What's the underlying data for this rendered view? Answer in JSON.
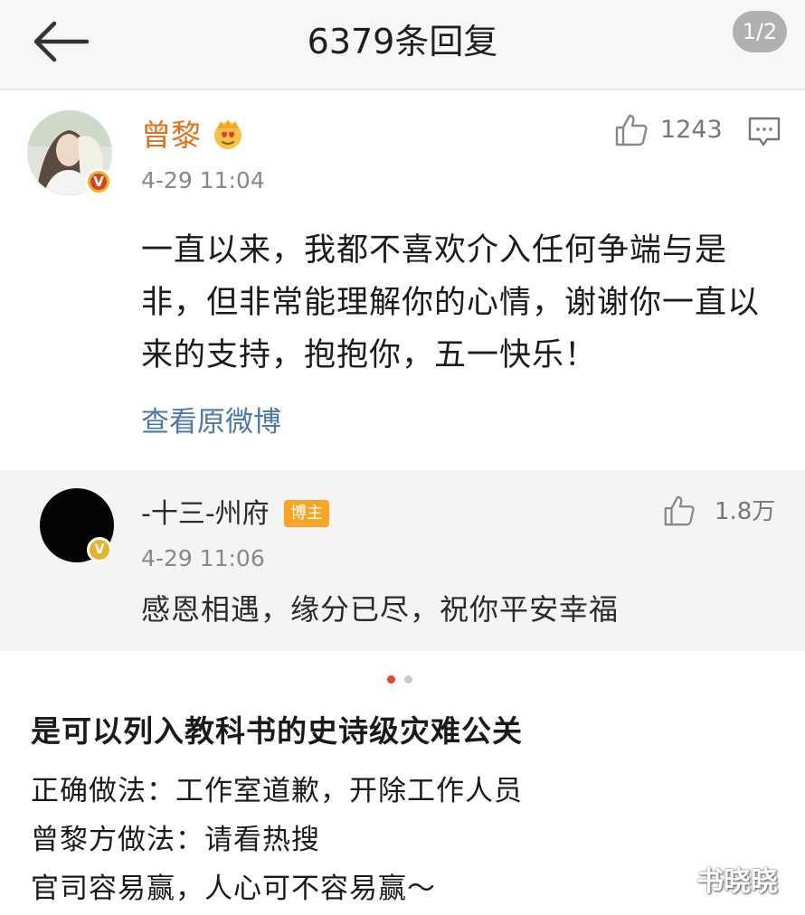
{
  "header": {
    "title": "6379条回复",
    "page_indicator": "1/2"
  },
  "main_comment": {
    "username": "曾黎",
    "time": "4-29 11:04",
    "like_count": "1243",
    "content": "一直以来，我都不喜欢介入任何争端与是非，但非常能理解你的心情，谢谢你一直以来的支持，抱抱你，五一快乐！",
    "view_original": "查看原微博"
  },
  "reply": {
    "username": "-十三-州府",
    "badge": "博主",
    "time": "4-29 11:06",
    "like_count": "1.8万",
    "content": "感恩相遇，缘分已尽，祝你平安幸福"
  },
  "pager": {
    "active_index": 0,
    "count": 2
  },
  "article": {
    "title": "是可以列入教科书的史诗级灾难公关",
    "line1": "正确做法：工作室道歉，开除工作人员",
    "line2": "曾黎方做法：请看热搜",
    "line3": "官司容易赢，人心可不容易赢～"
  },
  "watermark": "书晓晓",
  "colors": {
    "username_orange": "#e0701b",
    "link_blue": "#4a79a9",
    "badge_orange": "#f6a623",
    "dot_active": "#e5403a"
  }
}
